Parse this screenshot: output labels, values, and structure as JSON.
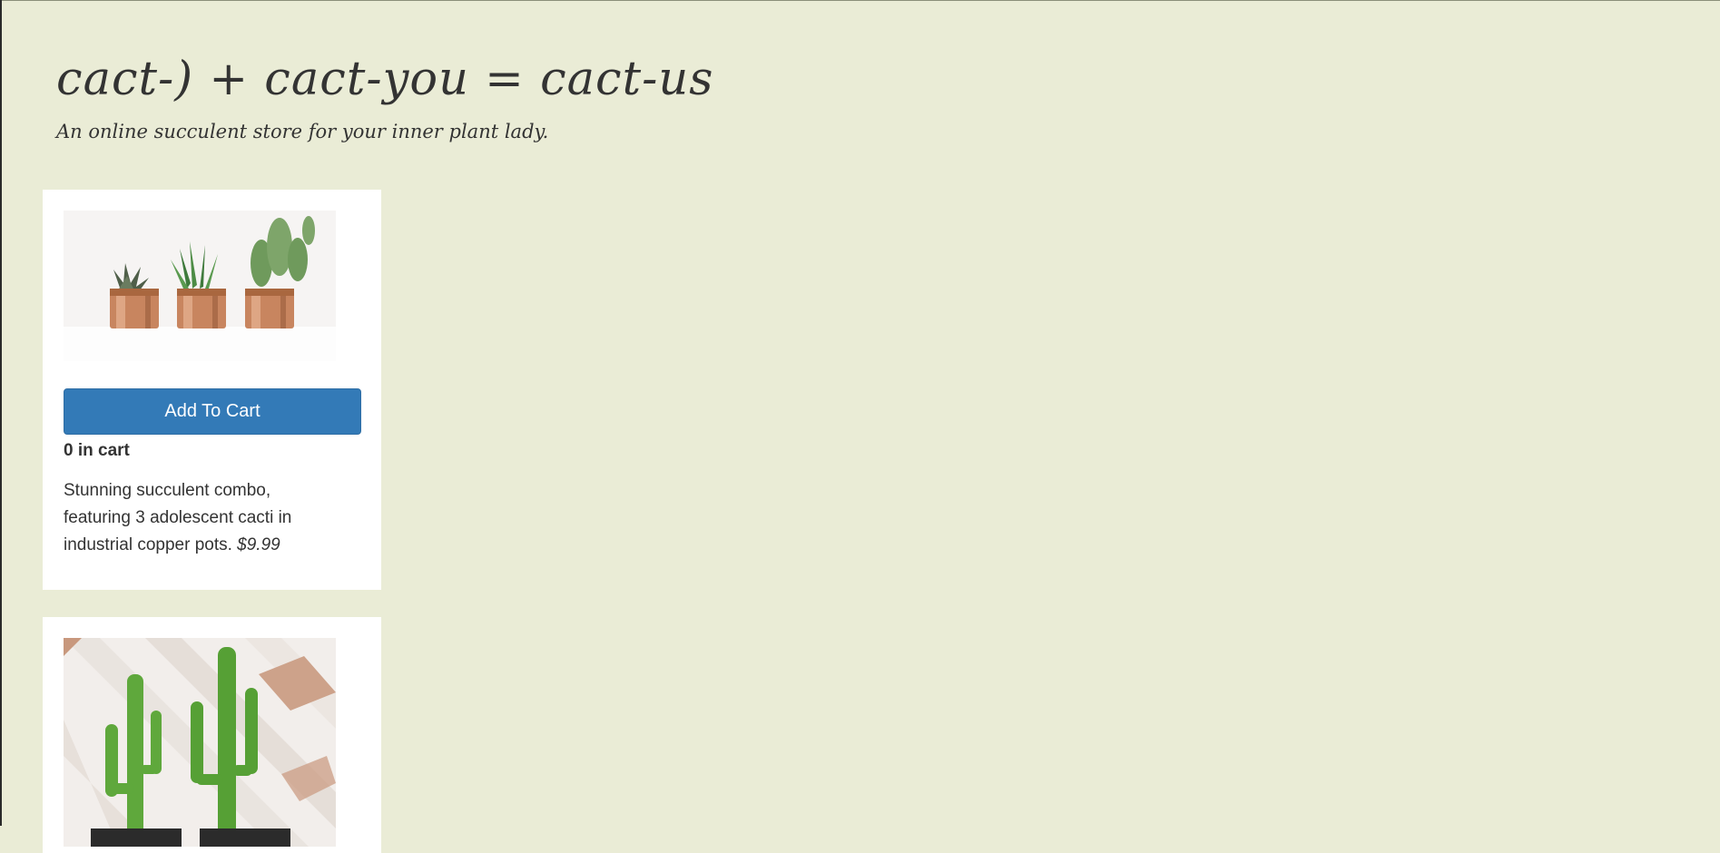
{
  "header": {
    "title": "cact-) + cact-you = cact-us",
    "tagline": "An online succulent store for your inner plant lady."
  },
  "products": [
    {
      "image_alt": "Three succulents in copper pots",
      "add_to_cart_label": "Add To Cart",
      "cart_count": "0 in cart",
      "description": "Stunning succulent combo, featuring 3 adolescent cacti in industrial copper pots.",
      "price": "$9.99"
    },
    {
      "image_alt": "Two tall cacti against a white wooden wall"
    }
  ],
  "colors": {
    "background": "#eaecd6",
    "button": "#337ab7",
    "card": "#ffffff",
    "text": "#333333"
  }
}
